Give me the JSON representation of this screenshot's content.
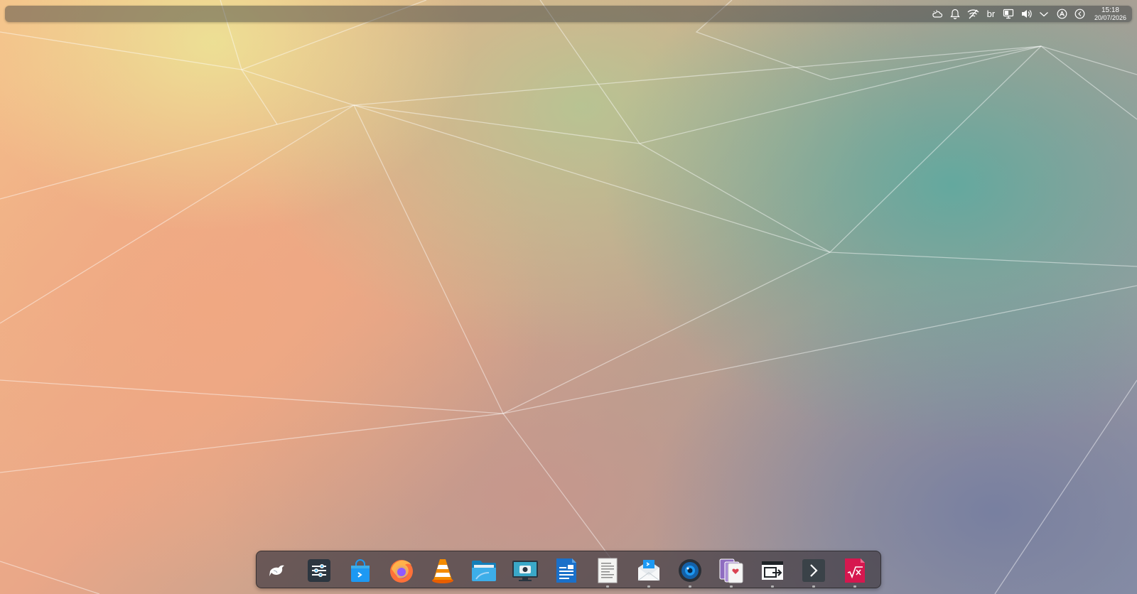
{
  "top_panel": {
    "tray_items": [
      {
        "icon": "weather-icon"
      },
      {
        "icon": "notifications-bell-icon"
      },
      {
        "icon": "network-wireless-icon"
      },
      {
        "icon": "keyboard-layout-text",
        "label": "br"
      },
      {
        "icon": "display-configuration-icon"
      },
      {
        "icon": "volume-icon"
      },
      {
        "icon": "tray-expand-chevron-icon"
      },
      {
        "icon": "accessibility-icon"
      },
      {
        "icon": "back-circle-icon"
      }
    ],
    "keyboard_layout": "br",
    "clock": {
      "time": "15:18",
      "date": "20/07/2026"
    }
  },
  "dock": {
    "items": [
      {
        "name": "app-launcher",
        "icon": "launcher-swan-icon",
        "running": false
      },
      {
        "name": "system-settings",
        "icon": "sliders-icon",
        "running": false
      },
      {
        "name": "software-store",
        "icon": "shopping-bag-icon",
        "running": false
      },
      {
        "name": "firefox",
        "icon": "firefox-icon",
        "running": false
      },
      {
        "name": "vlc",
        "icon": "vlc-cone-icon",
        "running": false
      },
      {
        "name": "file-manager",
        "icon": "folder-icon",
        "running": false
      },
      {
        "name": "screenshot-tool",
        "icon": "camera-monitor-icon",
        "running": false
      },
      {
        "name": "writer",
        "icon": "document-writer-icon",
        "running": false
      },
      {
        "name": "text-editor",
        "icon": "text-document-icon",
        "running": true
      },
      {
        "name": "mail-client",
        "icon": "mail-icon",
        "running": true
      },
      {
        "name": "camera-app",
        "icon": "webcam-icon",
        "running": true
      },
      {
        "name": "card-game",
        "icon": "playing-cards-icon",
        "running": true
      },
      {
        "name": "window-switcher",
        "icon": "window-export-icon",
        "running": true
      },
      {
        "name": "terminal",
        "icon": "terminal-prompt-icon",
        "running": true
      },
      {
        "name": "math-formula",
        "icon": "math-sqrt-icon",
        "running": true
      }
    ]
  },
  "colors": {
    "panel_bg": "#2e3438",
    "dock_bg": "#423c42",
    "running_indicator": "#bebebe"
  }
}
